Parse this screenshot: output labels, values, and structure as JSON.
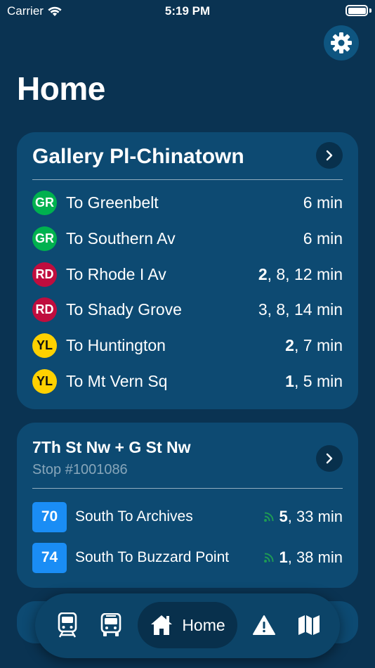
{
  "status_bar": {
    "carrier": "Carrier",
    "time": "5:19 PM"
  },
  "header": {
    "title": "Home"
  },
  "station_card": {
    "name": "Gallery Pl-Chinatown",
    "arrivals": [
      {
        "line": "GR",
        "color": "#00b14f",
        "text_color": "#ffffff",
        "destination": "To Greenbelt",
        "first": "",
        "rest": "6",
        "unit": "min"
      },
      {
        "line": "GR",
        "color": "#00b14f",
        "text_color": "#ffffff",
        "destination": "To Southern Av",
        "first": "",
        "rest": "6",
        "unit": "min"
      },
      {
        "line": "RD",
        "color": "#bf0d3e",
        "text_color": "#ffffff",
        "destination": "To Rhode I Av",
        "first": "2",
        "rest": ", 8, 12",
        "unit": "min"
      },
      {
        "line": "RD",
        "color": "#bf0d3e",
        "text_color": "#ffffff",
        "destination": "To Shady Grove",
        "first": "",
        "rest": "3, 8, 14",
        "unit": "min"
      },
      {
        "line": "YL",
        "color": "#ffd100",
        "text_color": "#111111",
        "destination": "To Huntington",
        "first": "2",
        "rest": ", 7",
        "unit": "min"
      },
      {
        "line": "YL",
        "color": "#ffd100",
        "text_color": "#111111",
        "destination": "To Mt Vern Sq",
        "first": "1",
        "rest": ", 5",
        "unit": "min"
      }
    ]
  },
  "bus_card": {
    "name": "7Th St Nw + G St Nw",
    "stop_number": "Stop #1001086",
    "arrivals": [
      {
        "route": "70",
        "destination": "South To Archives",
        "first": "5",
        "rest": ", 33",
        "unit": "min"
      },
      {
        "route": "74",
        "destination": "South To Buzzard Point",
        "first": "1",
        "rest": ", 38",
        "unit": "min"
      }
    ]
  },
  "tab_bar": {
    "home_label": "Home"
  }
}
